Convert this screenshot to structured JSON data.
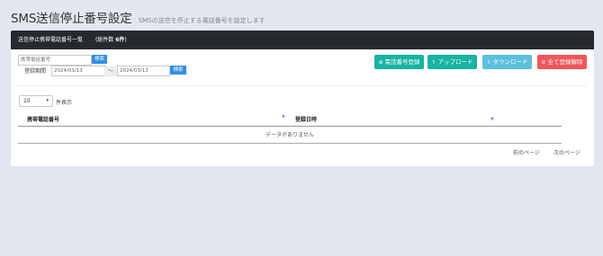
{
  "header": {
    "title": "SMS送信停止番号設定",
    "subtitle": "SMSの送信を停止する電話番号を設定します"
  },
  "panel": {
    "title": "送信停止携帯電話番号一覧",
    "count_label": "(総件数",
    "count_value": "6件",
    "count_close": ")"
  },
  "filter": {
    "phone_placeholder": "携帯電話番号",
    "search_label": "検索",
    "period_label": "登録期間",
    "date_from": "2024/03/13",
    "range_sep": "～",
    "date_to": "2024/03/13",
    "search2_label": "検索"
  },
  "actions": {
    "register": {
      "label": "電話番号登録",
      "color": "#17b3a3"
    },
    "upload": {
      "label": "アップロード",
      "color": "#17b3a3"
    },
    "download": {
      "label": "ダウンロード",
      "color": "#5bc0de"
    },
    "delete_all": {
      "label": "全て登録解除",
      "color": "#f0575b"
    }
  },
  "table": {
    "page_length": "10",
    "page_length_label": "件表示",
    "columns": [
      "携帯電話番号",
      "登録日時"
    ],
    "empty_text": "データがありません"
  },
  "pager": {
    "prev": "前のページ",
    "next": "次のページ"
  }
}
